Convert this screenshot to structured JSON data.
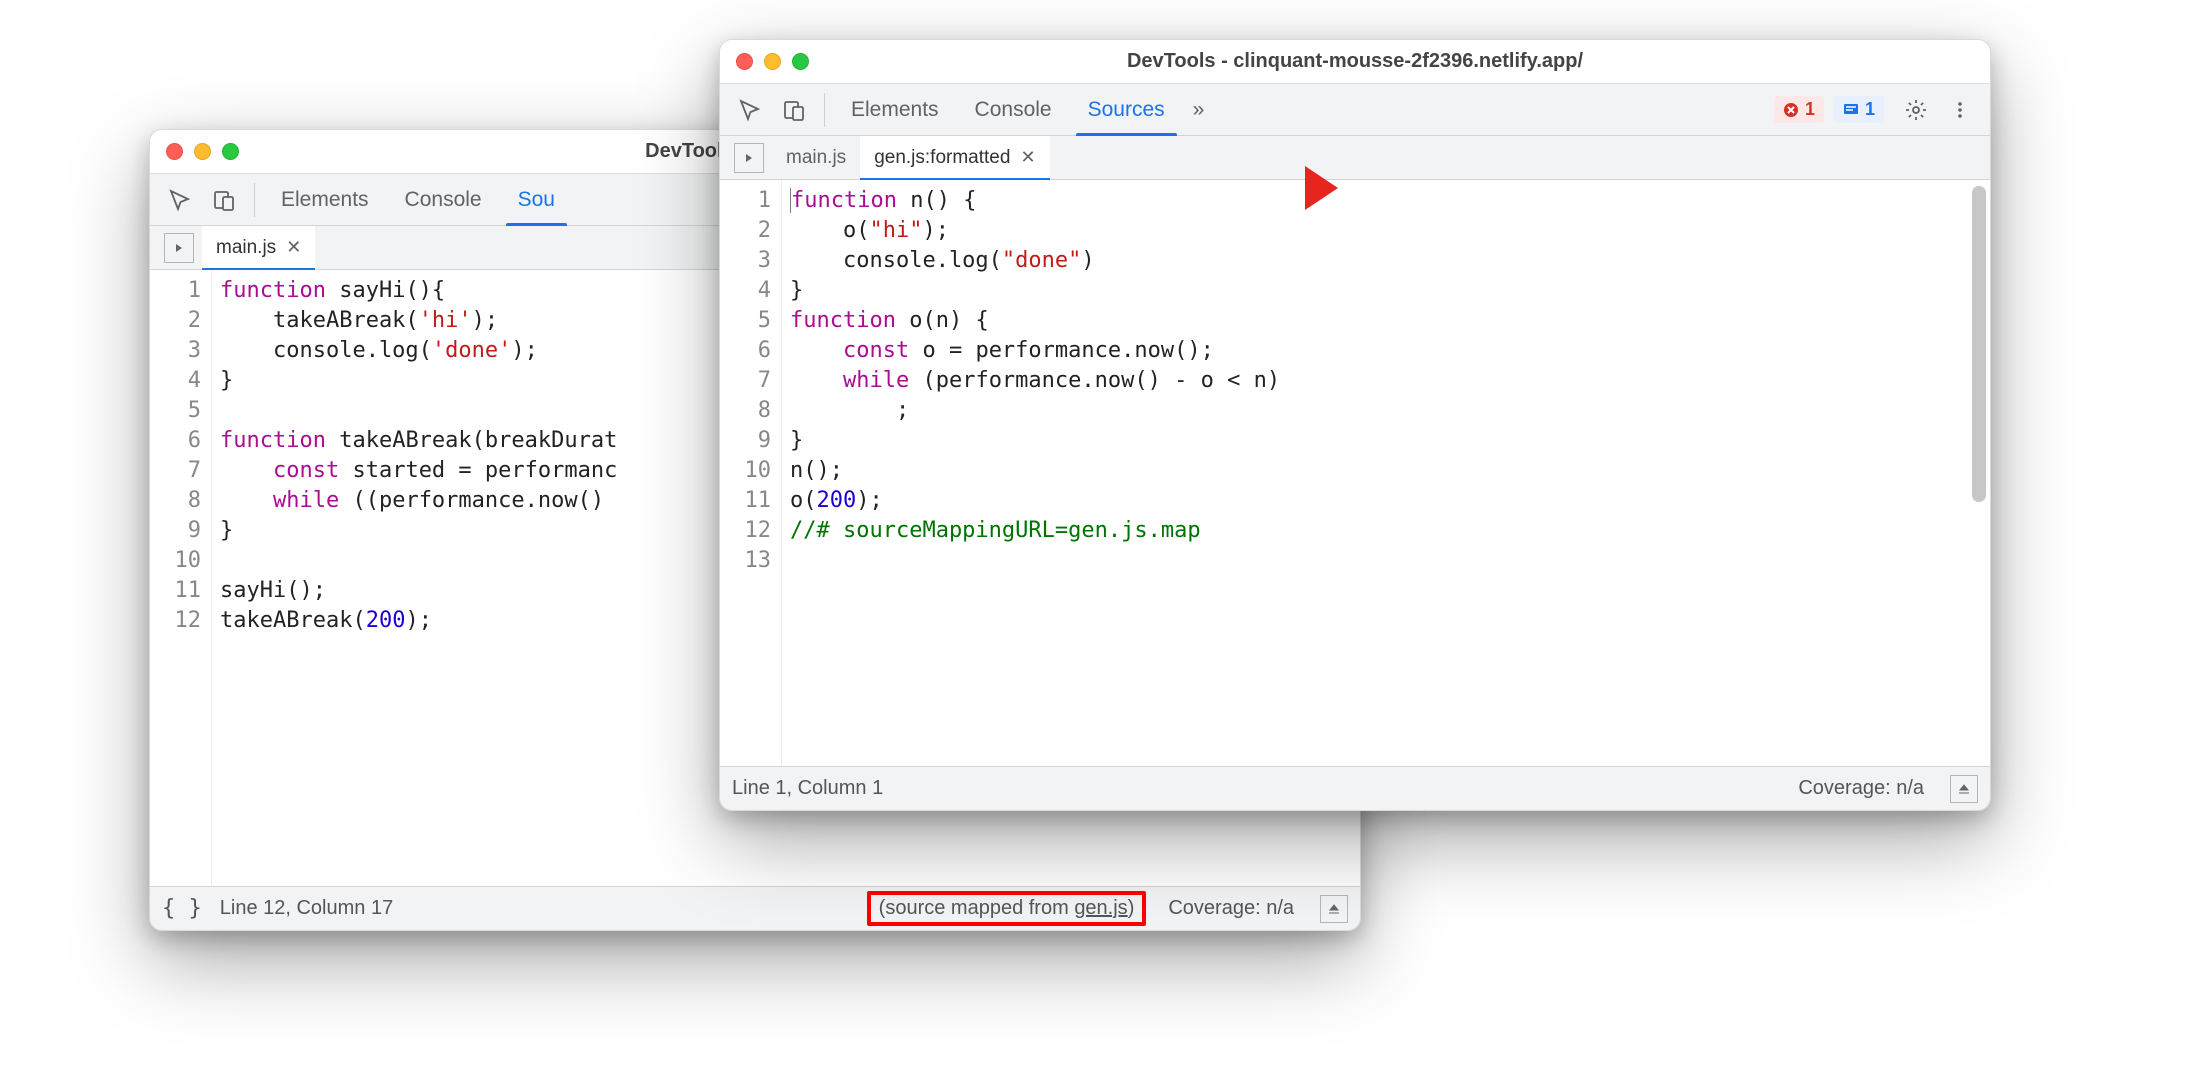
{
  "back_window": {
    "title": "DevTools - clinquant-m",
    "panels": {
      "elements": "Elements",
      "console": "Console",
      "sources": "Sou"
    },
    "tabs": [
      {
        "label": "main.js",
        "active": true
      }
    ],
    "gutter": " 1\n 2\n 3\n 4\n 5\n 6\n 7\n 8\n 9\n10\n11\n12",
    "status": {
      "pos": "Line 12, Column 17",
      "mapped_prefix": "(source mapped from ",
      "mapped_link": "gen.js",
      "mapped_suffix": ")",
      "coverage": "Coverage: n/a"
    }
  },
  "front_window": {
    "title": "DevTools - clinquant-mousse-2f2396.netlify.app/",
    "panels": {
      "elements": "Elements",
      "console": "Console",
      "sources": "Sources",
      "more": "»"
    },
    "err_count": "1",
    "info_count": "1",
    "tabs": {
      "mainjs": "main.js",
      "genjs": "gen.js:formatted"
    },
    "gutter": " 1\n 2\n 3\n 4\n 5\n 6\n 7\n 8\n 9\n10\n11\n12\n13",
    "status": {
      "pos": "Line 1, Column 1",
      "coverage": "Coverage: n/a"
    }
  },
  "code": {
    "back": {
      "l1a": "function",
      "l1b": " sayHi(){",
      "l2a": "    takeABreak(",
      "l2b": "'hi'",
      "l2c": ");",
      "l3a": "    console.log(",
      "l3b": "'done'",
      "l3c": ");",
      "l4": "}",
      "l5": "",
      "l6a": "function",
      "l6b": " takeABreak(breakDurat",
      "l7a": "    ",
      "l7b": "const",
      "l7c": " started = performanc",
      "l8a": "    ",
      "l8b": "while",
      "l8c": " ((performance.now()",
      "l9": "}",
      "l10": "",
      "l11": "sayHi();",
      "l12a": "takeABreak(",
      "l12b": "200",
      "l12c": ");"
    },
    "front": {
      "l1a": "function",
      "l1b": " n() {",
      "l2a": "    o(",
      "l2b": "\"hi\"",
      "l2c": ");",
      "l3a": "    console.log(",
      "l3b": "\"done\"",
      "l3c": ")",
      "l4": "}",
      "l5a": "function",
      "l5b": " o(n) {",
      "l6a": "    ",
      "l6b": "const",
      "l6c": " o = performance.now();",
      "l7a": "    ",
      "l7b": "while",
      "l7c": " (performance.now() - o < n)",
      "l8": "        ;",
      "l9": "}",
      "l10": "n();",
      "l11a": "o(",
      "l11b": "200",
      "l11c": ");",
      "l12": "//# sourceMappingURL=gen.js.map",
      "l13": ""
    }
  }
}
